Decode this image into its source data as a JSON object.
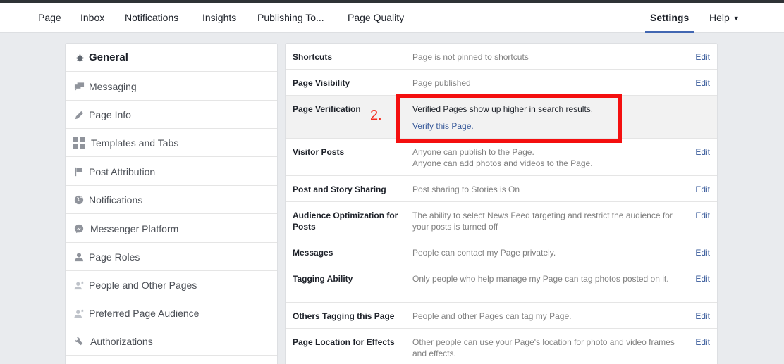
{
  "nav": {
    "items": [
      {
        "label": "Page"
      },
      {
        "label": "Inbox"
      },
      {
        "label": "Notifications"
      },
      {
        "label": "Insights"
      },
      {
        "label": "Publishing To..."
      },
      {
        "label": "Page Quality"
      },
      {
        "label": "Settings"
      },
      {
        "label": "Help"
      }
    ],
    "active": "Settings",
    "accent_color": "#4267b2"
  },
  "sidebar": {
    "items": [
      {
        "label": "General",
        "icon": "gear-icon",
        "active": true
      },
      {
        "label": "Messaging",
        "icon": "messaging-icon"
      },
      {
        "label": "Page Info",
        "icon": "pencil-icon"
      },
      {
        "label": "Templates and Tabs",
        "icon": "grid-icon"
      },
      {
        "label": "Post Attribution",
        "icon": "flag-icon"
      },
      {
        "label": "Notifications",
        "icon": "globe-icon"
      },
      {
        "label": "Messenger Platform",
        "icon": "messenger-icon"
      },
      {
        "label": "Page Roles",
        "icon": "person-icon"
      },
      {
        "label": "People and Other Pages",
        "icon": "person-star-icon"
      },
      {
        "label": "Preferred Page Audience",
        "icon": "person-star-icon"
      },
      {
        "label": "Authorizations",
        "icon": "wrench-icon"
      }
    ]
  },
  "settings": {
    "edit_label": "Edit",
    "rows": [
      {
        "name": "Shortcuts",
        "value": "Page is not pinned to shortcuts"
      },
      {
        "name": "Page Visibility",
        "value": "Page published"
      },
      {
        "name": "Page Verification",
        "value": "Verified Pages show up higher in search results.",
        "link": "Verify this Page."
      },
      {
        "name": "Visitor Posts",
        "value": "Anyone can publish to the Page.",
        "value2": "Anyone can add photos and videos to the Page."
      },
      {
        "name": "Post and Story Sharing",
        "value": "Post sharing to Stories is On"
      },
      {
        "name": "Audience Optimization for Posts",
        "value": "The ability to select News Feed targeting and restrict the audience for your posts is turned off"
      },
      {
        "name": "Messages",
        "value": "People can contact my Page privately."
      },
      {
        "name": "Tagging Ability",
        "value": "Only people who help manage my Page can tag photos posted on it."
      },
      {
        "name": "Others Tagging this Page",
        "value": "People and other Pages can tag my Page."
      },
      {
        "name": "Page Location for Effects",
        "value": "Other people can use your Page's location for photo and video frames and effects."
      }
    ]
  },
  "annotation": {
    "number": "2.",
    "color": "#f40f0f"
  }
}
